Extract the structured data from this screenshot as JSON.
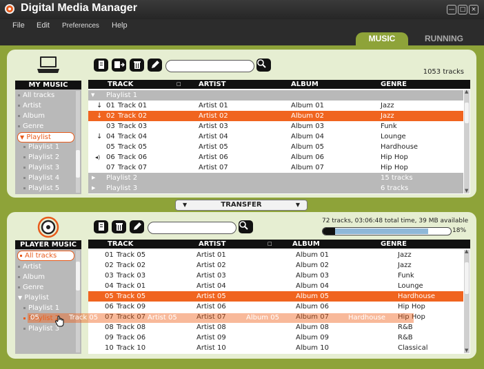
{
  "window": {
    "title": "Digital Media Manager",
    "min": "—",
    "max": "□",
    "close": "×"
  },
  "menu": [
    "File",
    "Edit",
    "Preferences",
    "Help"
  ],
  "tabs": [
    {
      "label": "MUSIC",
      "active": true
    },
    {
      "label": "RUNNING",
      "active": false
    }
  ],
  "colors": {
    "accent": "#8ea339",
    "highlight": "#f0641f",
    "header": "#111111"
  },
  "my_music": {
    "header": "MY MUSIC",
    "track_count": "1053 tracks",
    "sidebar": [
      "All tracks",
      "Artist",
      "Album",
      "Genre",
      "Playlist",
      "Playlist 1",
      "Playlist 2",
      "Playlist 3",
      "Playlist 4",
      "Playlist 5"
    ],
    "columns": [
      "TRACK",
      "ARTIST",
      "ALBUM",
      "GENRE"
    ],
    "groups": [
      {
        "name": "Playlist 1",
        "info": ""
      },
      {
        "name": "Playlist 2",
        "info": "15 tracks"
      },
      {
        "name": "Playlist 3",
        "info": "6 tracks"
      }
    ],
    "rows": [
      {
        "icon": "↓",
        "num": "01",
        "track": "Track 01",
        "artist": "Artist 01",
        "album": "Album 01",
        "genre": "Jazz"
      },
      {
        "icon": "↓",
        "num": "02",
        "track": "Track 02",
        "artist": "Artist 02",
        "album": "Album 02",
        "genre": "Jazz"
      },
      {
        "icon": "",
        "num": "03",
        "track": "Track 03",
        "artist": "Artist 03",
        "album": "Album 03",
        "genre": "Funk"
      },
      {
        "icon": "↓",
        "num": "04",
        "track": "Track 04",
        "artist": "Artist 04",
        "album": "Album 04",
        "genre": "Lounge"
      },
      {
        "icon": "",
        "num": "05",
        "track": "Track 05",
        "artist": "Artist 05",
        "album": "Album 05",
        "genre": "Hardhouse"
      },
      {
        "icon": "◂)",
        "num": "06",
        "track": "Track 06",
        "artist": "Artist 06",
        "album": "Album 06",
        "genre": "Hip Hop"
      },
      {
        "icon": "",
        "num": "07",
        "track": "Track 07",
        "artist": "Artist 07",
        "album": "Album 07",
        "genre": "Hip Hop"
      }
    ]
  },
  "transfer": {
    "label": "TRANSFER"
  },
  "player_music": {
    "header": "PLAYER MUSIC",
    "status": "72 tracks, 03:06:48 total time, 39 MB available",
    "capacity_percent": 18,
    "capacity_label": "18%",
    "sidebar": [
      "All tracks",
      "Artist",
      "Album",
      "Genre",
      "Playlist",
      "Playlist 1",
      "Playlist 2",
      "Playlist 3"
    ],
    "columns": [
      "TRACK",
      "ARTIST",
      "ALBUM",
      "GENRE"
    ],
    "rows": [
      {
        "num": "01",
        "track": "Track 05",
        "artist": "Artist 01",
        "album": "Album 01",
        "genre": "Jazz"
      },
      {
        "num": "02",
        "track": "Track 02",
        "artist": "Artist 02",
        "album": "Album 02",
        "genre": "Jazz"
      },
      {
        "num": "03",
        "track": "Track 03",
        "artist": "Artist 03",
        "album": "Album 03",
        "genre": "Funk"
      },
      {
        "num": "04",
        "track": "Track 01",
        "artist": "Artist 04",
        "album": "Album 04",
        "genre": "Lounge"
      },
      {
        "num": "05",
        "track": "Track 05",
        "artist": "Artist 05",
        "album": "Album 05",
        "genre": "Hardhouse"
      },
      {
        "num": "06",
        "track": "Track 09",
        "artist": "Artist 06",
        "album": "Album 06",
        "genre": "Hip Hop"
      },
      {
        "num": "07",
        "track": "Track 07",
        "artist": "Artist 07",
        "album": "Album 07",
        "genre": "Hip Hop"
      },
      {
        "num": "08",
        "track": "Track 08",
        "artist": "Artist 08",
        "album": "Album 08",
        "genre": "R&B"
      },
      {
        "num": "09",
        "track": "Track 06",
        "artist": "Artist 09",
        "album": "Album 09",
        "genre": "R&B"
      },
      {
        "num": "10",
        "track": "Track 10",
        "artist": "Artist 10",
        "album": "Album 10",
        "genre": "Classical"
      }
    ],
    "drag_ghost": {
      "num": "05",
      "track": "Track 05",
      "artist": "Artist 05",
      "album": "Album 05",
      "genre": "Hardhouse"
    }
  }
}
